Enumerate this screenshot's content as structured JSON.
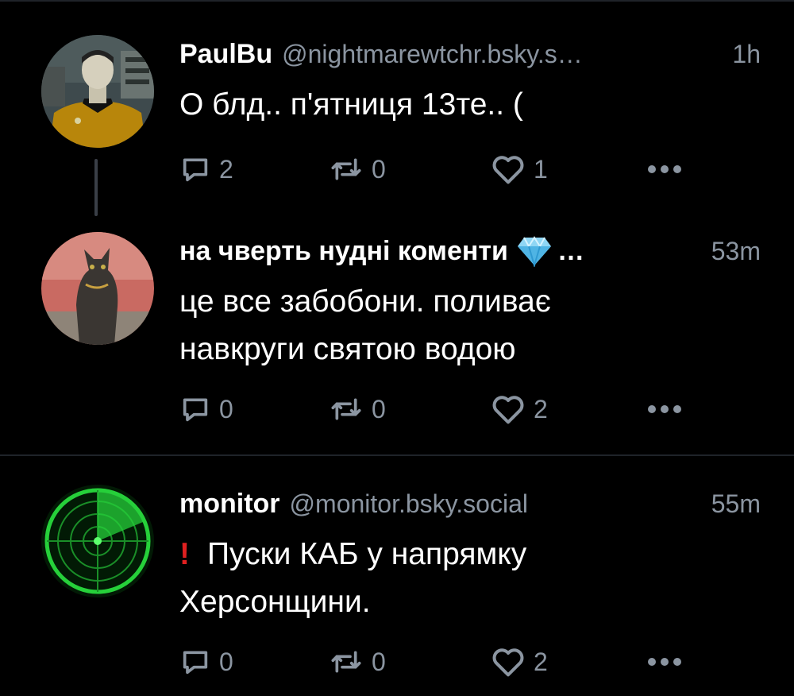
{
  "posts": [
    {
      "name": "PaulBu",
      "handle": "@nightmarewtchr.bsky.s…",
      "time": "1h",
      "text": "О блд.. п'ятниця 13те.. (",
      "counts": {
        "reply": "2",
        "repost": "0",
        "like": "1"
      }
    },
    {
      "name": "на чверть нудні коменти",
      "name_suffix": "…",
      "time": "53m",
      "text_lines": [
        "це все забобони. поливає",
        "навкруги святою водою"
      ],
      "counts": {
        "reply": "0",
        "repost": "0",
        "like": "2"
      }
    },
    {
      "name": "monitor",
      "handle": "@monitor.bsky.social",
      "time": "55m",
      "text_lines": [
        "Пуски КАБ у напрямку",
        "Херсонщини."
      ],
      "counts": {
        "reply": "0",
        "repost": "0",
        "like": "2"
      }
    }
  ],
  "icons": {
    "reply": "reply-icon",
    "repost": "repost-icon",
    "like": "heart-icon",
    "more": "more-options-icon",
    "diamond": "diamond-emoji-icon",
    "exclamation": "red-exclamation-icon"
  },
  "colors": {
    "background": "#000000",
    "muted": "#8b95a1",
    "alert": "#e02020",
    "radar": "#26d03a"
  }
}
